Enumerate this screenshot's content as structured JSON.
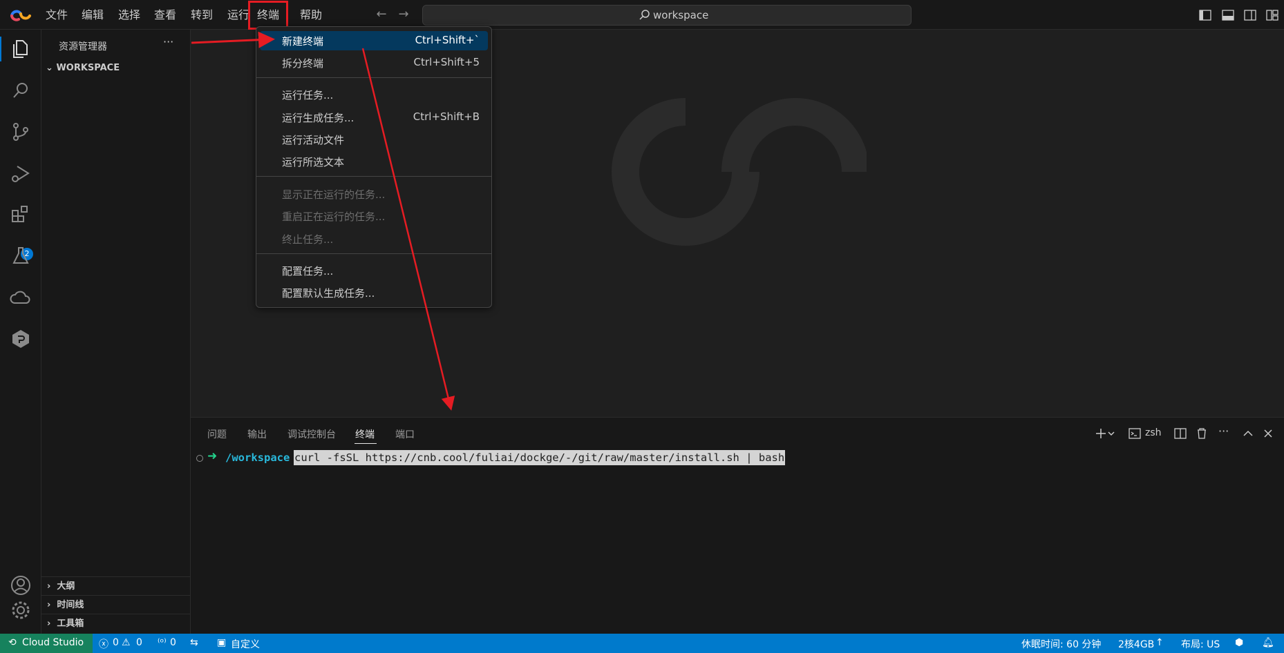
{
  "titlebar": {
    "menus": [
      "文件",
      "编辑",
      "选择",
      "查看",
      "转到",
      "运行",
      "终端",
      "帮助"
    ],
    "search_text": "workspace"
  },
  "activitybar": {
    "icons": [
      "files-icon",
      "search-icon",
      "source-control-icon",
      "run-debug-icon",
      "extensions-icon",
      "testing-icon",
      "cloud-icon",
      "package-icon",
      "account-icon",
      "settings-gear-icon"
    ],
    "extensions_badge": "2"
  },
  "sidebar": {
    "title": "资源管理器",
    "more": "···",
    "workspace": "WORKSPACE",
    "sections": [
      "大纲",
      "时间线",
      "工具箱"
    ]
  },
  "terminal_menu": {
    "groups": [
      [
        {
          "label": "新建终端",
          "key": "Ctrl+Shift+`",
          "active": true
        },
        {
          "label": "拆分终端",
          "key": "Ctrl+Shift+5"
        }
      ],
      [
        {
          "label": "运行任务...",
          "key": ""
        },
        {
          "label": "运行生成任务...",
          "key": "Ctrl+Shift+B"
        },
        {
          "label": "运行活动文件",
          "key": ""
        },
        {
          "label": "运行所选文本",
          "key": ""
        }
      ],
      [
        {
          "label": "显示正在运行的任务...",
          "key": "",
          "disabled": true
        },
        {
          "label": "重启正在运行的任务...",
          "key": "",
          "disabled": true
        },
        {
          "label": "终止任务...",
          "key": "",
          "disabled": true
        }
      ],
      [
        {
          "label": "配置任务...",
          "key": ""
        },
        {
          "label": "配置默认生成任务...",
          "key": ""
        }
      ]
    ]
  },
  "panel": {
    "tabs": [
      "问题",
      "输出",
      "调试控制台",
      "终端",
      "端口"
    ],
    "active_tab": "终端",
    "shell": "zsh",
    "prompt_arrow": "➜",
    "cwd": "/workspace",
    "command": "curl -fsSL https://cnb.cool/fuliai/dockge/-/git/raw/master/install.sh | bash"
  },
  "statusbar": {
    "remote": "Cloud Studio",
    "errors": "0",
    "warnings": "0",
    "ports": "0",
    "customize": "自定义",
    "idle": "休眠时间: 60 分钟",
    "machine": "2核4GB",
    "layout": "布局: US"
  },
  "colors": {
    "accent": "#0078d4",
    "status_bar": "#007acc",
    "remote": "#16825d",
    "annotation_red": "#e51c23",
    "menu_highlight": "#04395e"
  }
}
